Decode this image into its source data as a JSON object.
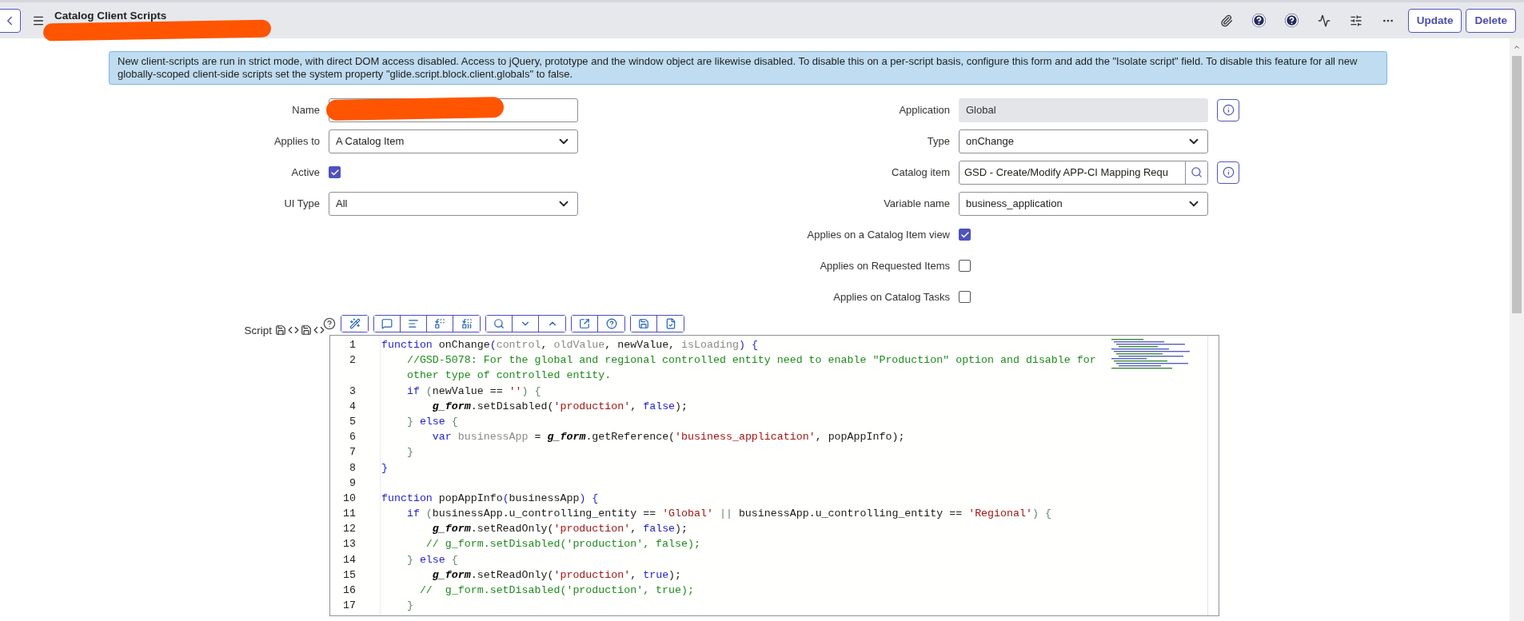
{
  "header": {
    "title": "Catalog Client Scripts",
    "actions": [
      {
        "label": "Update"
      },
      {
        "label": "Delete"
      }
    ]
  },
  "notice": "New client-scripts are run in strict mode, with direct DOM access disabled. Access to jQuery, prototype and the window object are likewise disabled. To disable this on a per-script basis, configure this form and add the \"Isolate script\" field. To disable this feature for all new globally-scoped client-side scripts set the system property \"glide.script.block.client.globals\" to false.",
  "left_fields": [
    {
      "label": "Name",
      "kind": "text",
      "redacted": true
    },
    {
      "label": "Applies to",
      "kind": "select",
      "value": "A Catalog Item"
    },
    {
      "label": "Active",
      "kind": "checkbox",
      "checked": true
    },
    {
      "label": "UI Type",
      "kind": "select",
      "value": "All"
    }
  ],
  "right_fields": [
    {
      "label": "Application",
      "kind": "readonly",
      "value": "Global",
      "info": true
    },
    {
      "label": "Type",
      "kind": "select",
      "value": "onChange"
    },
    {
      "label": "Catalog item",
      "kind": "reference",
      "value": "GSD - Create/Modify APP-CI Mapping Requ",
      "info": true
    },
    {
      "label": "Variable name",
      "kind": "select",
      "value": "business_application"
    },
    {
      "label": "Applies on a Catalog Item view",
      "kind": "checkbox",
      "checked": true
    },
    {
      "label": "Applies on Requested Items",
      "kind": "checkbox",
      "checked": false
    },
    {
      "label": "Applies on Catalog Tasks",
      "kind": "checkbox",
      "checked": false
    }
  ],
  "script": {
    "label": "Script",
    "lines": [
      {
        "number": "1",
        "tokens": [
          {
            "text": "function",
            "kind": "kw"
          },
          {
            "text": " onChange",
            "kind": "plain"
          },
          {
            "text": "(",
            "kind": "kw"
          },
          {
            "text": "control",
            "kind": "param"
          },
          {
            "text": ", ",
            "kind": "plain"
          },
          {
            "text": "oldValue",
            "kind": "param"
          },
          {
            "text": ", newValue, ",
            "kind": "plain"
          },
          {
            "text": "isLoading",
            "kind": "param"
          },
          {
            "text": ") {",
            "kind": "kw"
          }
        ]
      },
      {
        "number": "2",
        "tokens": [
          {
            "text": "    //GSD-5078: For the global and regional controlled entity need to enable \"Production\" option and disable for",
            "kind": "comment"
          }
        ]
      },
      {
        "tokens": [
          {
            "text": "    other type of controlled entity.",
            "kind": "comment"
          }
        ]
      },
      {
        "number": "3",
        "tokens": [
          {
            "text": "    if",
            "kind": "kw"
          },
          {
            "text": " (",
            "kind": "bracket"
          },
          {
            "text": "newValue == ",
            "kind": "plain"
          },
          {
            "text": "''",
            "kind": "str"
          },
          {
            "text": ") {",
            "kind": "bracket"
          }
        ]
      },
      {
        "number": "4",
        "tokens": [
          {
            "text": "        g_form",
            "kind": "obj"
          },
          {
            "text": ".setDisabled(",
            "kind": "plain"
          },
          {
            "text": "'production'",
            "kind": "str"
          },
          {
            "text": ", ",
            "kind": "plain"
          },
          {
            "text": "false",
            "kind": "kw"
          },
          {
            "text": ");",
            "kind": "plain"
          }
        ]
      },
      {
        "number": "5",
        "tokens": [
          {
            "text": "    } ",
            "kind": "bracket"
          },
          {
            "text": "else",
            "kind": "kw"
          },
          {
            "text": " {",
            "kind": "bracket"
          }
        ]
      },
      {
        "number": "6",
        "tokens": [
          {
            "text": "        var",
            "kind": "kw"
          },
          {
            "text": " businessApp",
            "kind": "param"
          },
          {
            "text": " = ",
            "kind": "plain"
          },
          {
            "text": "g_form",
            "kind": "obj"
          },
          {
            "text": ".getReference(",
            "kind": "plain"
          },
          {
            "text": "'business_application'",
            "kind": "str"
          },
          {
            "text": ", popAppInfo);",
            "kind": "plain"
          }
        ]
      },
      {
        "number": "7",
        "tokens": [
          {
            "text": "    }",
            "kind": "bracket"
          }
        ]
      },
      {
        "number": "8",
        "tokens": [
          {
            "text": "}",
            "kind": "kw"
          }
        ]
      },
      {
        "number": "9"
      },
      {
        "number": "10",
        "tokens": [
          {
            "text": "function",
            "kind": "kw"
          },
          {
            "text": " popAppInfo",
            "kind": "plain"
          },
          {
            "text": "(",
            "kind": "kw"
          },
          {
            "text": "businessApp",
            "kind": "plain"
          },
          {
            "text": ") {",
            "kind": "kw"
          }
        ]
      },
      {
        "number": "11",
        "tokens": [
          {
            "text": "    if",
            "kind": "kw"
          },
          {
            "text": " (",
            "kind": "bracket"
          },
          {
            "text": "businessApp.u_controlling_entity == ",
            "kind": "plain"
          },
          {
            "text": "'Global'",
            "kind": "str"
          },
          {
            "text": " || ",
            "kind": "bracket"
          },
          {
            "text": "businessApp.u_controlling_entity == ",
            "kind": "plain"
          },
          {
            "text": "'Regional'",
            "kind": "str"
          },
          {
            "text": ") {",
            "kind": "bracket"
          }
        ]
      },
      {
        "number": "12",
        "tokens": [
          {
            "text": "        g_form",
            "kind": "obj"
          },
          {
            "text": ".setReadOnly(",
            "kind": "plain"
          },
          {
            "text": "'production'",
            "kind": "str"
          },
          {
            "text": ", ",
            "kind": "plain"
          },
          {
            "text": "false",
            "kind": "kw"
          },
          {
            "text": ");",
            "kind": "plain"
          }
        ]
      },
      {
        "number": "13",
        "tokens": [
          {
            "text": "       // g_form.setDisabled('production', false);",
            "kind": "comment"
          }
        ]
      },
      {
        "number": "14",
        "tokens": [
          {
            "text": "    } ",
            "kind": "bracket"
          },
          {
            "text": "else",
            "kind": "kw"
          },
          {
            "text": " {",
            "kind": "bracket"
          }
        ]
      },
      {
        "number": "15",
        "tokens": [
          {
            "text": "        g_form",
            "kind": "obj"
          },
          {
            "text": ".setReadOnly(",
            "kind": "plain"
          },
          {
            "text": "'production'",
            "kind": "str"
          },
          {
            "text": ", ",
            "kind": "plain"
          },
          {
            "text": "true",
            "kind": "kw"
          },
          {
            "text": ");",
            "kind": "plain"
          }
        ]
      },
      {
        "number": "16",
        "tokens": [
          {
            "text": "      //  g_form.setDisabled('production', true);",
            "kind": "comment"
          }
        ]
      },
      {
        "number": "17",
        "tokens": [
          {
            "text": "    }",
            "kind": "bracket"
          }
        ]
      }
    ]
  }
}
